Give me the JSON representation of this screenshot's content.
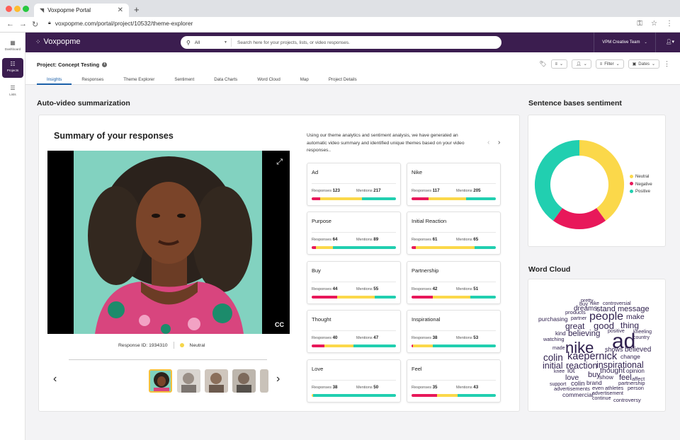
{
  "browser": {
    "tab_title": "Voxpopme Portal",
    "url": "voxpopme.com/portal/project/10532/theme-explorer"
  },
  "rail": [
    {
      "label": "Dashboard",
      "icon": "grid-icon"
    },
    {
      "label": "Projects",
      "icon": "projects-icon",
      "active": true
    },
    {
      "label": "Lists",
      "icon": "list-icon"
    }
  ],
  "topbar": {
    "logo": "Voxpopme",
    "search_scope": "All",
    "search_placeholder": "Search here for your projects, lists, or video responses.",
    "team": "VPM Creative Team"
  },
  "project": {
    "title": "Project: Concept Testing",
    "tabs": [
      "Insights",
      "Responses",
      "Theme Explorer",
      "Sentiment",
      "Data Charts",
      "Word Cloud",
      "Map",
      "Project Details"
    ],
    "active_tab": "Insights",
    "tools": {
      "filter": "Filter",
      "dates": "Dates"
    }
  },
  "summary": {
    "section_title": "Auto-video summarization",
    "card_title": "Summary of your responses",
    "cc": "CC",
    "response_id_label": "Response ID:",
    "response_id": "1934310",
    "sentiment": "Neutral",
    "description": "Using our theme analytics and sentiment analysis, we have generated an automatic video summary and identified unique themes based on your video responses..",
    "responses_label": "Responses",
    "mentions_label": "Mentions",
    "themes": [
      {
        "name": "Ad",
        "responses": "123",
        "mentions": "217",
        "bar": [
          0.1,
          0.5,
          0.4
        ]
      },
      {
        "name": "Nike",
        "responses": "117",
        "mentions": "205",
        "bar": [
          0.2,
          0.45,
          0.35
        ]
      },
      {
        "name": "Purpose",
        "responses": "64",
        "mentions": "89",
        "bar": [
          0.05,
          0.2,
          0.75
        ]
      },
      {
        "name": "Initial Reaction",
        "responses": "61",
        "mentions": "65",
        "bar": [
          0.05,
          0.7,
          0.25
        ]
      },
      {
        "name": "Buy",
        "responses": "44",
        "mentions": "55",
        "bar": [
          0.3,
          0.45,
          0.25
        ]
      },
      {
        "name": "Partnership",
        "responses": "42",
        "mentions": "51",
        "bar": [
          0.25,
          0.45,
          0.3
        ]
      },
      {
        "name": "Thought",
        "responses": "40",
        "mentions": "47",
        "bar": [
          0.15,
          0.35,
          0.5
        ]
      },
      {
        "name": "Inspirational",
        "responses": "38",
        "mentions": "53",
        "bar": [
          0.02,
          0.23,
          0.75
        ]
      },
      {
        "name": "Love",
        "responses": "38",
        "mentions": "50",
        "bar": [
          0.0,
          0.02,
          0.98
        ]
      },
      {
        "name": "Feel",
        "responses": "35",
        "mentions": "43",
        "bar": [
          0.3,
          0.25,
          0.45
        ]
      }
    ]
  },
  "sentiment": {
    "section_title": "Sentence bases sentiment",
    "legend": [
      "Neutral",
      "Negative",
      "Positive"
    ],
    "colors": {
      "neutral": "#fbd84a",
      "negative": "#e8185a",
      "positive": "#21cfb0"
    },
    "values": {
      "neutral": 0.4,
      "negative": 0.2,
      "positive": 0.4
    }
  },
  "wordcloud": {
    "section_title": "Word Cloud",
    "words": [
      "pretty",
      "buy",
      "nike",
      "controversial",
      "dreams",
      "stand",
      "message",
      "products",
      "people",
      "purchasing",
      "partner",
      "make",
      "great",
      "good",
      "thing",
      "positive",
      "kneeling",
      "kind",
      "believing",
      "country",
      "watching",
      "ad",
      "nike",
      "made",
      "shows",
      "believed",
      "colin",
      "kaepernick",
      "change",
      "initial",
      "reaction",
      "inspirational",
      "knee",
      "lot",
      "thought",
      "opinion",
      "love",
      "buy",
      "show",
      "feel",
      "affect",
      "support",
      "colin",
      "brand",
      "partnership",
      "advertisements",
      "even",
      "athletes",
      "person",
      "commercial",
      "advertisement",
      "continue",
      "controversy"
    ]
  }
}
